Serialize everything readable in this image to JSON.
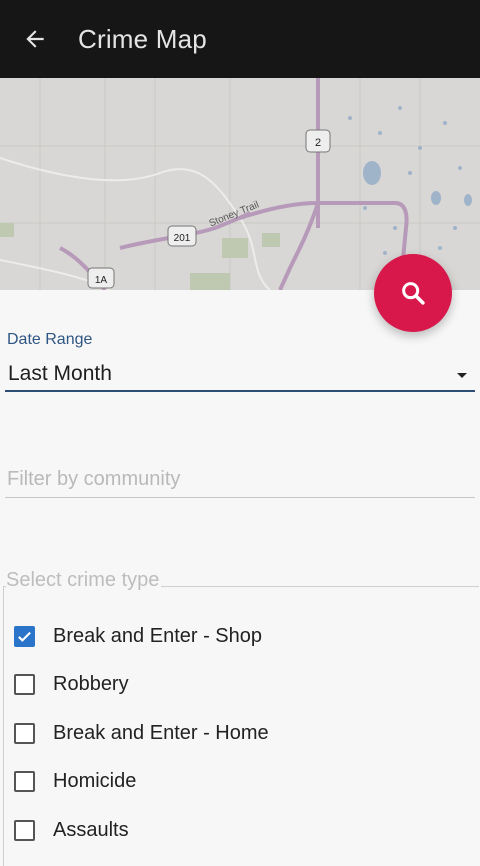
{
  "app_bar": {
    "title": "Crime Map"
  },
  "map": {
    "route_labels": [
      "2",
      "201",
      "1A"
    ],
    "road_label": "Stoney Trail"
  },
  "filters": {
    "date_range_label": "Date Range",
    "date_range_value": "Last Month",
    "community_placeholder": "Filter by community",
    "crime_type_label": "Select crime type",
    "crime_types": [
      {
        "label": "Break and Enter - Shop",
        "checked": true
      },
      {
        "label": "Robbery",
        "checked": false
      },
      {
        "label": "Break and Enter - Home",
        "checked": false
      },
      {
        "label": "Homicide",
        "checked": false
      },
      {
        "label": "Assaults",
        "checked": false
      }
    ]
  },
  "colors": {
    "fab": "#d8174a",
    "checkbox_checked": "#2a74c9",
    "app_bar": "#161616"
  }
}
